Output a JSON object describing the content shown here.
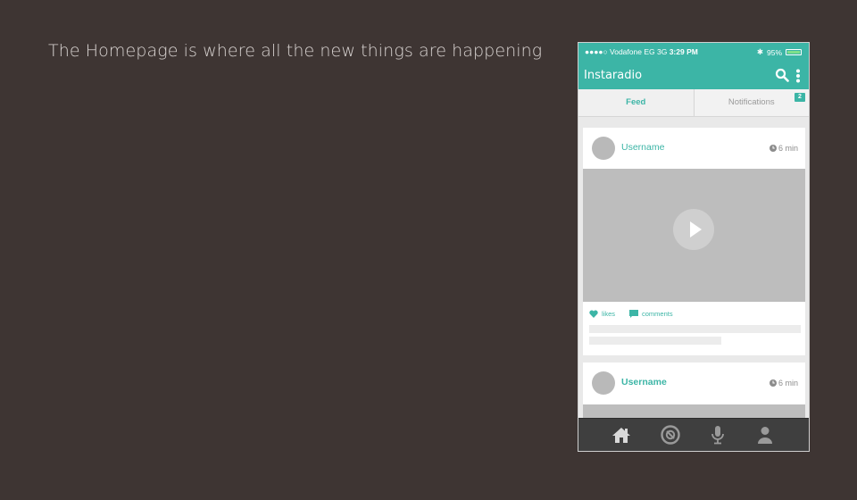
{
  "caption": "The Homepage is where all the new things are happening",
  "phone": {
    "statusbar": {
      "carrier": "●●●●○ Vodafone EG",
      "network": "3G",
      "time": "3:29 PM",
      "bluetooth": "✱",
      "battery_text": "95%"
    },
    "appbar": {
      "title": "Instaradio"
    },
    "tabs": [
      {
        "label": "Feed",
        "active": true
      },
      {
        "label": "Notifications",
        "badge": "2"
      }
    ],
    "posts": [
      {
        "username": "Username",
        "time": "6 min",
        "likes_label": "likes",
        "comments_label": "comments"
      },
      {
        "username": "Username",
        "time": "6 min"
      }
    ],
    "bottom_nav": [
      "home-icon",
      "discover-icon",
      "microphone-icon",
      "profile-icon"
    ]
  },
  "colors": {
    "accent": "#3cb5a6",
    "background": "#3e3533",
    "nav": "#3f3f3f"
  }
}
